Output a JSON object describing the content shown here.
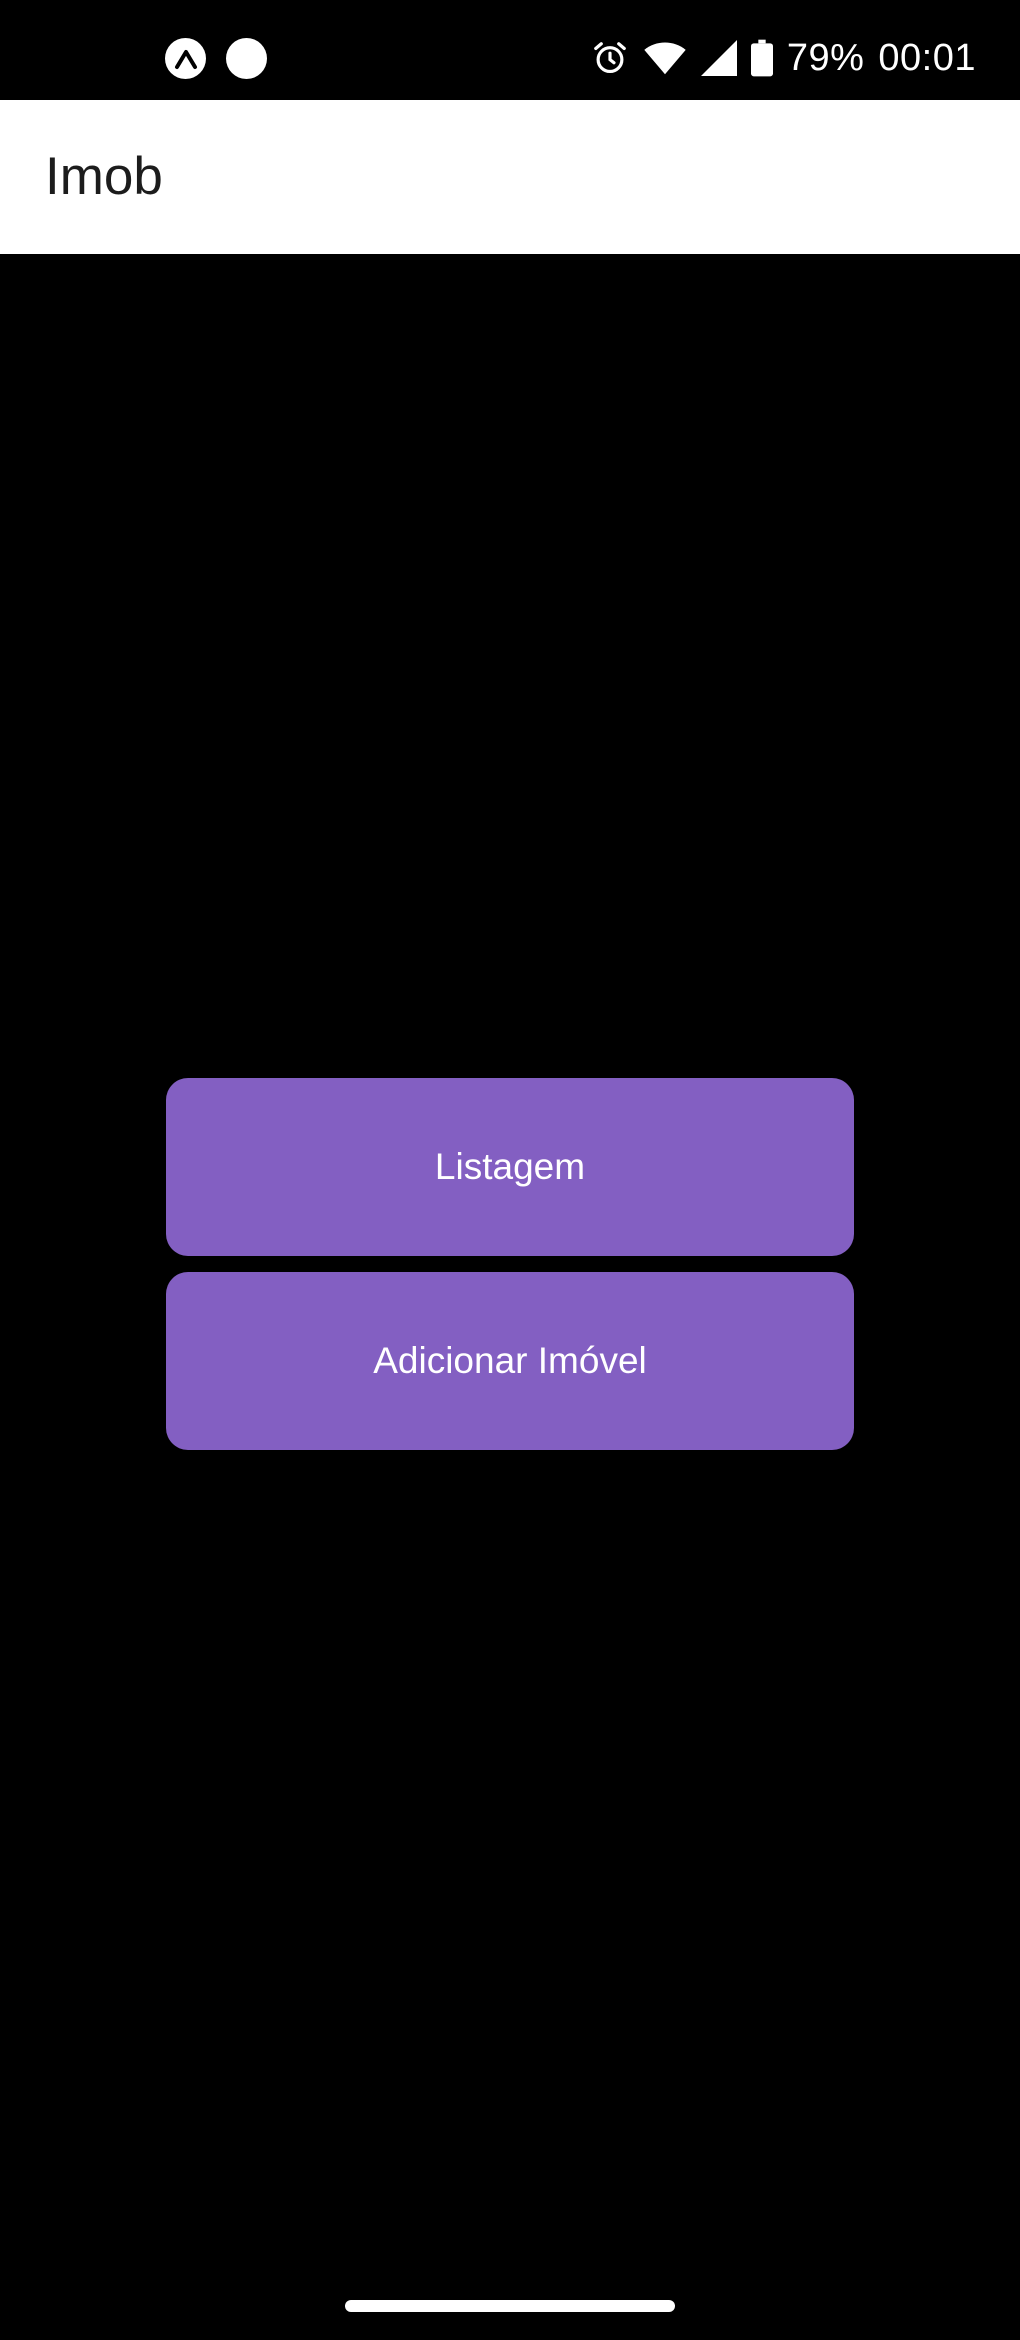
{
  "status_bar": {
    "battery": "79%",
    "time": "00:01",
    "left_icons": [
      "expo-notification-icon",
      "circle-notification-icon"
    ],
    "right_icons": [
      "alarm-icon",
      "wifi-icon",
      "signal-icon",
      "battery-icon"
    ]
  },
  "app_bar": {
    "title": "Imob",
    "background": "#ffffff"
  },
  "main": {
    "buttons": [
      {
        "label": "Listagem",
        "color": "#835fc2"
      },
      {
        "label": "Adicionar Imóvel",
        "color": "#835fc2"
      }
    ]
  },
  "theme": {
    "background": "#000000",
    "accent": "#835fc2"
  }
}
